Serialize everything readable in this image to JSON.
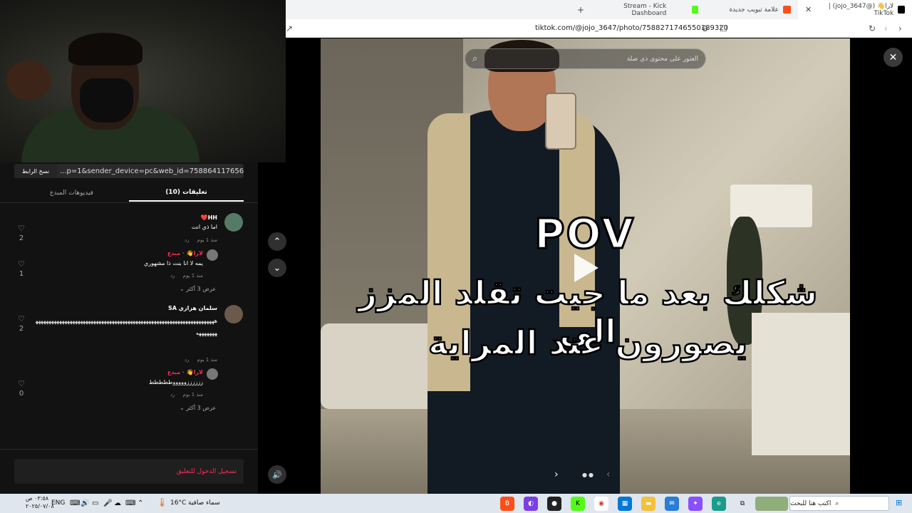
{
  "browser": {
    "tabs": [
      {
        "title": "لارا👋 (@jojo_3647) | TikTok",
        "active": true,
        "color": "#000000"
      },
      {
        "title": "علامة تبويب جديدة",
        "active": false,
        "color": "#ff4e1a"
      },
      {
        "title": "Stream - Kick Dashboard",
        "active": false,
        "color": "#53fc18"
      }
    ],
    "new_tab": "+",
    "url": "tiktok.com/@jojo_3647/photo/7588271746550189320"
  },
  "panel": {
    "copy_link": "نسخ الرابط",
    "link_text": "...p=1&sender_device=pc&web_id=7588641176560109067",
    "tab_comments": "(10) تعليقات",
    "tab_creator_videos": "فيديوهات المبدع",
    "comments": [
      {
        "name": "HH❤️",
        "text": "اما ذي انت",
        "time": "منذ 1 يوم",
        "reply": "رد",
        "likes": "2"
      },
      {
        "name": "لارا👋 · مبدع",
        "text": "يمه لا انا بنت ذا مشهوري",
        "time": "منذ 1 يوم",
        "reply": "رد",
        "likes": "1"
      },
      {
        "name": "سلمان هزازي SA",
        "text": "ههههههههههههههههههههههههههههههههههههههههههههههههههههههههههههههههههههههههههههه",
        "time": "منذ 1 يوم",
        "reply": "رد",
        "likes": "2"
      },
      {
        "name": "لارا👋 · مبدع",
        "text": "ززززززوووووططططط",
        "time": "منذ 1 يوم",
        "reply": "رد",
        "likes": "0"
      }
    ],
    "view_more": "عرض 3 أكثر",
    "login_prompt": "تسجيل الدخول للتعليق"
  },
  "photo": {
    "search_placeholder": "العثور على محتوى ذي صلة",
    "pov": "POV",
    "caption_line1": "شكلك بعد ما جيت تقلد المزز الي",
    "caption_line2": "يصورون عند المراية"
  },
  "taskbar": {
    "time": "٠٣:٥٨ ص",
    "date": "٢٠٢٥/٠٧/٠٨",
    "lang": "ENG",
    "weather_temp": "16°C",
    "weather_desc": "سماء صافية",
    "search_placeholder": "اكتب هنا للبحث"
  },
  "colors": {
    "accent": "#fe2c55",
    "panel_bg": "#121212",
    "taskbar_bg": "#dfe6ee"
  }
}
